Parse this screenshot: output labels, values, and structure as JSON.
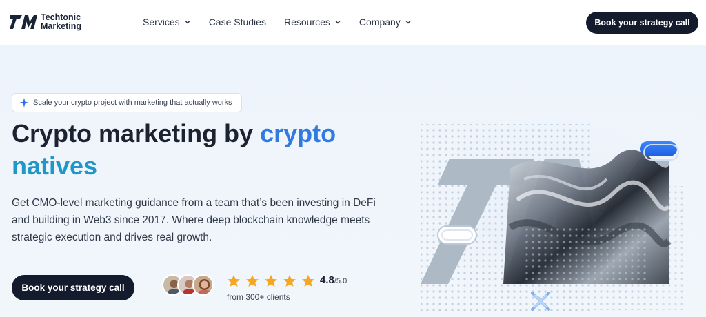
{
  "brand": {
    "mark": "TM",
    "name_line1": "Techtonic",
    "name_line2": "Marketing"
  },
  "nav": {
    "items": [
      {
        "label": "Services",
        "has_dropdown": true
      },
      {
        "label": "Case Studies",
        "has_dropdown": false
      },
      {
        "label": "Resources",
        "has_dropdown": true
      },
      {
        "label": "Company",
        "has_dropdown": true
      }
    ],
    "cta_label": "Book your strategy call"
  },
  "hero": {
    "pill_text": "Scale your crypto project with marketing that actually works",
    "headline_part1": "Crypto marketing by ",
    "headline_accent1": "crypto",
    "headline_accent2": "natives",
    "description": "Get CMO-level marketing guidance from a team that’s been investing in DeFi and building in Web3 since 2017. Where deep blockchain knowledge meets strategic execution and drives real growth.",
    "cta_label": "Book your strategy call",
    "rating_value": "4.8",
    "rating_max": "/5.0",
    "rating_stars": 5,
    "clients_text": "from 300+ clients"
  },
  "colors": {
    "dark": "#141b2d",
    "accent_blue": "#2f7be0",
    "accent_teal": "#1f98c9",
    "star": "#f5a623"
  },
  "icons": {
    "logo": "tm-logo-icon",
    "dropdown": "chevron-down-icon",
    "pill": "sparkle-icon",
    "star": "star-icon"
  }
}
